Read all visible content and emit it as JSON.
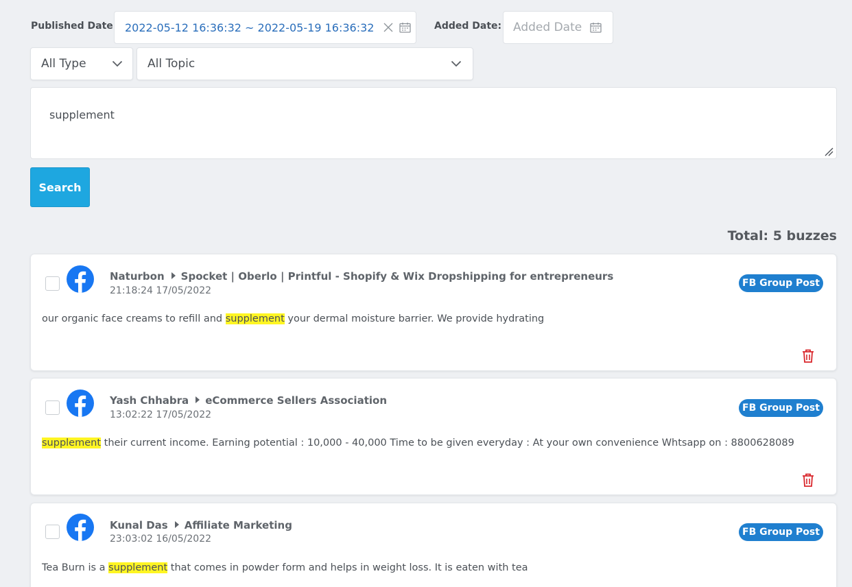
{
  "filters": {
    "published_label": "Published Date:",
    "published_range": "2022-05-12 16:36:32 ~ 2022-05-19 16:36:32",
    "added_label": "Added Date:",
    "added_placeholder": "Added Date",
    "type_value": "All Type",
    "topic_value": "All Topic",
    "query": "supplement",
    "search_label": "Search"
  },
  "results": {
    "total_label": "Total: 5 buzzes",
    "posts": [
      {
        "author": "Naturbon",
        "group": "Spocket | Oberlo | Printful - Shopify & Wix Dropshipping for entrepreneurs",
        "time": "21:18:24 17/05/2022",
        "text_before": "our organic face creams to refill and ",
        "highlight": "supplement",
        "text_after": " your dermal moisture barrier. We provide hydrating",
        "badge": "FB Group Post"
      },
      {
        "author": "Yash Chhabra",
        "group": "eCommerce Sellers Association",
        "time": "13:02:22 17/05/2022",
        "text_before": "",
        "highlight": "supplement",
        "text_after": " their current income. Earning potential : 10,000 - 40,000 Time to be given everyday : At your own convenience Whtsapp on : 8800628089",
        "badge": "FB Group Post"
      },
      {
        "author": "Kunal Das",
        "group": "Affiliate Marketing",
        "time": "23:03:02 16/05/2022",
        "text_before": "Tea Burn is a ",
        "highlight": "supplement",
        "text_after": " that comes in powder form and helps in weight loss. It is eaten with tea",
        "badge": "FB Group Post"
      }
    ]
  },
  "colors": {
    "accent": "#1ea7e0",
    "badge": "#1f7fcf",
    "facebook": "#1877f2",
    "highlight": "#fff523",
    "delete": "#d9262b"
  },
  "icons": [
    "close-icon",
    "calendar-icon",
    "chevron-down-icon",
    "resize-handle-icon",
    "facebook-icon",
    "caret-right-icon",
    "trash-icon"
  ]
}
